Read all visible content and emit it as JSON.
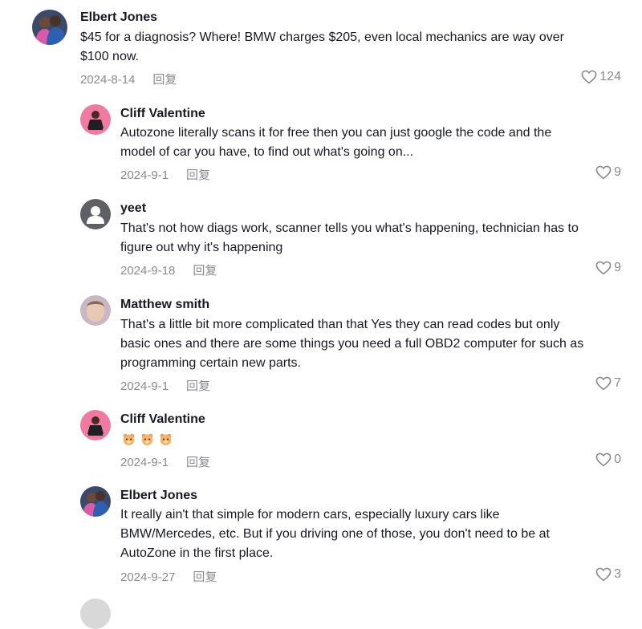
{
  "comments": [
    {
      "name": "Elbert Jones",
      "lines": [
        "$45 for a diagnosis? Where! BMW charges $205, even local mechanics are way over",
        "$100 now."
      ],
      "date": "2024-8-14",
      "reply": "回复",
      "likes": "124",
      "avatar": "couple-photo"
    },
    {
      "name": "Cliff Valentine",
      "lines": [
        "Autozone literally scans it for free then you can just google the code and the",
        "model of car you have, to find out what's going on..."
      ],
      "date": "2024-9-1",
      "reply": "回复",
      "likes": "9",
      "avatar": "pink-person"
    },
    {
      "name": "yeet",
      "lines": [
        "That's not how diags work, scanner tells you what's happening, technician has to",
        "figure out why it's happening"
      ],
      "date": "2024-9-18",
      "reply": "回复",
      "likes": "9",
      "avatar": "default-user"
    },
    {
      "name": "Matthew smith",
      "lines": [
        "That's a little bit more complicated than that Yes they can read codes but only",
        "basic ones and there are some things you need a full OBD2 computer for such as",
        "programming certain new parts."
      ],
      "date": "2024-9-1",
      "reply": "回复",
      "likes": "7",
      "avatar": "face-photo"
    },
    {
      "name": "Cliff Valentine",
      "emojis": [
        "hamster-emoji",
        "hamster-emoji",
        "hamster-emoji"
      ],
      "date": "2024-9-1",
      "reply": "回复",
      "likes": "0",
      "avatar": "pink-person"
    },
    {
      "name": "Elbert Jones",
      "lines": [
        "It really ain't that simple for modern cars, especially luxury cars like",
        "BMW/Mercedes, etc. But if you driving one of those, you don't need to be at",
        "AutoZone in the first place."
      ],
      "date": "2024-9-27",
      "reply": "回复",
      "likes": "3",
      "avatar": "couple-photo"
    }
  ],
  "colors": {
    "text": "#161823",
    "meta": "#8a8b91",
    "pink_avatar": "#f07aa0"
  }
}
